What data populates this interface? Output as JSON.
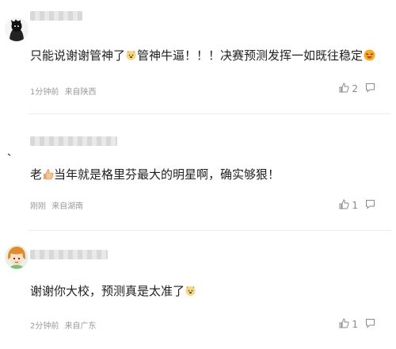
{
  "comments": [
    {
      "text_before": "只能说谢谢管神了",
      "text_after": "管神牛逼！！！决赛预测发挥一如既往稳定",
      "time": "1分钟前",
      "location": "来自陕西",
      "likes": "2"
    },
    {
      "text_before": "老",
      "text_after": "当年就是格里芬最大的明星啊，确实够狠！",
      "time": "刚刚",
      "location": "来自湖南",
      "likes": "1"
    },
    {
      "text_before": "谢谢你大校，预测真是太准了",
      "text_after": "",
      "time": "2分钟前",
      "location": "来自广东",
      "likes": "1"
    }
  ],
  "icons": {
    "like": "thumbs-up-icon",
    "reply": "comment-bubble-icon",
    "emoji_dog": "dog-face-emoji",
    "emoji_laugh": "laughing-face-emoji",
    "emoji_thumb": "thumbs-up-emoji"
  }
}
